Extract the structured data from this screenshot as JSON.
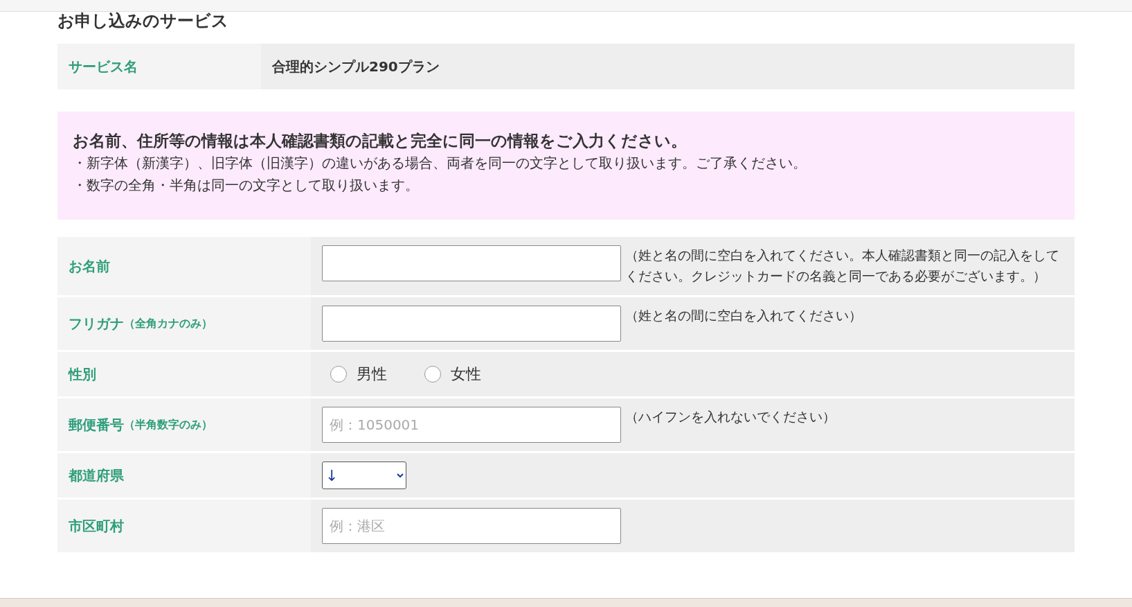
{
  "heading": "お申し込みのサービス",
  "service": {
    "label": "サービス名",
    "value": "合理的シンプル290プラン"
  },
  "notice": {
    "title": "お名前、住所等の情報は本人確認書類の記載と完全に同一の情報をご入力ください。",
    "lines": [
      "・新字体（新漢字）、旧字体（旧漢字）の違いがある場合、両者を同一の文字として取り扱います。ご了承ください。",
      "・数字の全角・半角は同一の文字として取り扱います。"
    ]
  },
  "fields": [
    {
      "kind": "text",
      "label": "お名前",
      "hint": "（姓と名の間に空白を入れてください。本人確認書類と同一の記入をしてください。クレジットカードの名義と同一である必要がございます。）"
    },
    {
      "kind": "text",
      "label": "フリガナ",
      "label_note": "（全角カナのみ）",
      "hint": "（姓と名の間に空白を入れてください）"
    },
    {
      "kind": "radio",
      "label": "性別",
      "options": [
        {
          "label": "男性",
          "selected": false
        },
        {
          "label": "女性",
          "selected": false
        }
      ]
    },
    {
      "kind": "text",
      "label": "郵便番号",
      "label_note": "（半角数字のみ）",
      "placeholder": "例：1050001",
      "hint": "（ハイフンを入れないでください）"
    },
    {
      "kind": "select",
      "label": "都道府県",
      "value": "↓"
    },
    {
      "kind": "text",
      "label": "市区町村",
      "placeholder": "例：港区"
    }
  ]
}
